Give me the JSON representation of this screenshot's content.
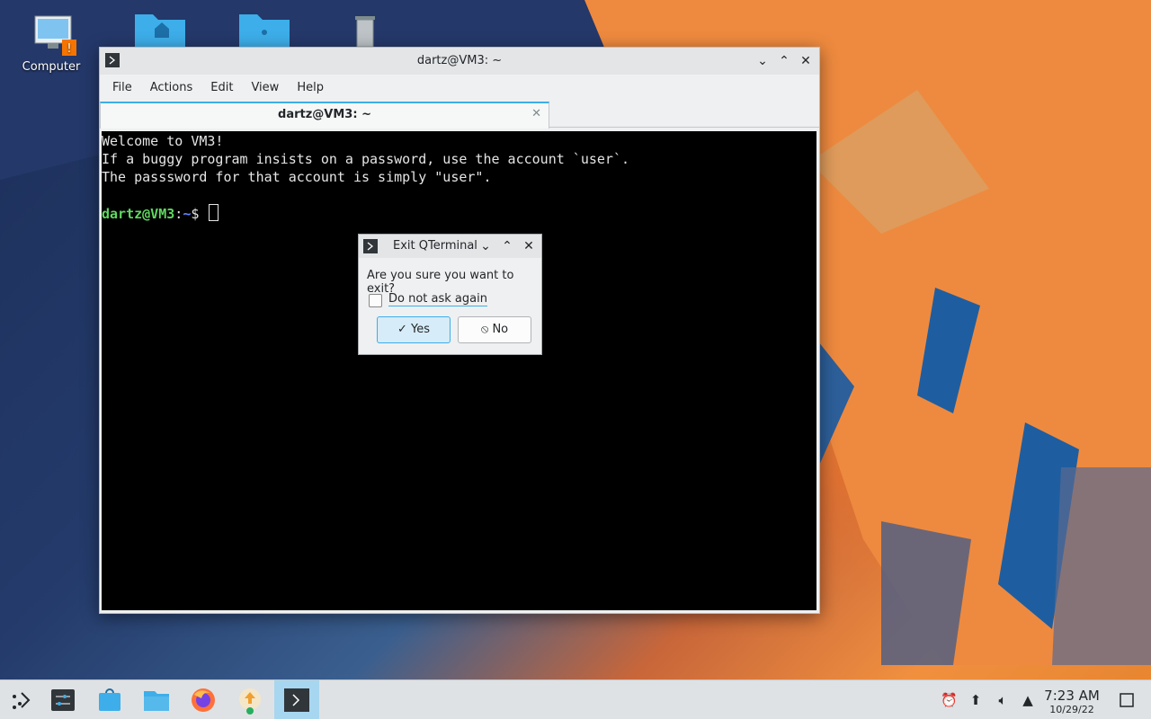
{
  "desktop": {
    "icons": [
      {
        "label": "Computer",
        "icon": "computer-icon"
      },
      {
        "label": "",
        "icon": "home-folder-icon"
      },
      {
        "label": "",
        "icon": "network-folder-icon"
      },
      {
        "label": "",
        "icon": "trash-icon"
      }
    ]
  },
  "terminal_window": {
    "title": "dartz@VM3: ~",
    "menu": [
      "File",
      "Actions",
      "Edit",
      "View",
      "Help"
    ],
    "tab_label": "dartz@VM3: ~",
    "lines": [
      "Welcome to VM3!",
      "If a buggy program insists on a password, use the account `user`.",
      "The passsword for that account is simply \"user\"."
    ],
    "prompt_user": "dartz@VM3",
    "prompt_sep": ":",
    "prompt_path": "~",
    "prompt_symbol": "$"
  },
  "dialog": {
    "title": "Exit QTerminal",
    "message": "Are you sure you want to exit?",
    "checkbox_label": "Do not ask again",
    "checkbox_checked": false,
    "yes_label": "Yes",
    "no_label": "No"
  },
  "taskbar": {
    "apps": [
      "app-launcher-icon",
      "system-settings-icon",
      "discover-icon",
      "file-manager-icon",
      "firefox-icon",
      "updates-icon",
      "terminal-icon"
    ],
    "active_app": "terminal-icon",
    "clock_time": "7:23 AM",
    "clock_date": "10/29/22"
  },
  "colors": {
    "accent": "#3daee9",
    "prompt_user": "#5fd75f",
    "prompt_path": "#5f87ff"
  }
}
